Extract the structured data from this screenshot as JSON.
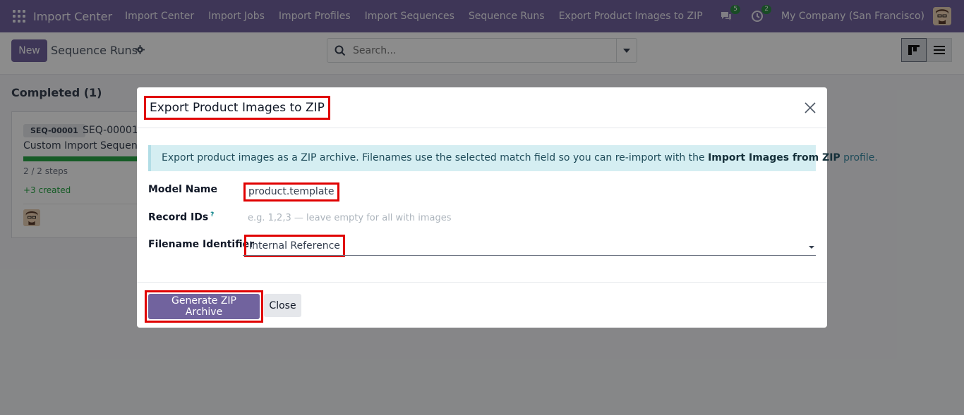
{
  "navbar": {
    "app_name": "Import Center",
    "menu": [
      "Import Center",
      "Import Jobs",
      "Import Profiles",
      "Import Sequences",
      "Sequence Runs",
      "Export Product Images to ZIP"
    ],
    "messages_count": "5",
    "activities_count": "2",
    "company": "My Company (San Francisco)"
  },
  "control": {
    "new_label": "New",
    "breadcrumb": "Sequence Runs",
    "search_placeholder": "Search..."
  },
  "kanban": {
    "group_title": "Completed (1)",
    "card": {
      "badge": "SEQ-00001",
      "name": "SEQ-00001 -",
      "description": "Custom Import Sequence",
      "progress": 1.0,
      "steps": "2 / 2 steps",
      "created": "+3 created"
    }
  },
  "dialog": {
    "title": "Export Product Images to ZIP",
    "alert_text_1": "Export product images as a ZIP archive. Filenames use the selected match field so you can re-import with the ",
    "alert_bold": "Import Images from ZIP",
    "alert_text_2": " profile.",
    "fields": {
      "model_name_label": "Model Name",
      "model_name_value": "product.template",
      "record_ids_label": "Record IDs",
      "record_ids_help": "?",
      "record_ids_placeholder": "e.g. 1,2,3 — leave empty for all with images",
      "filename_identifier_label": "Filename Identifier",
      "filename_identifier_value": "Internal Reference"
    },
    "generate_label": "Generate ZIP Archive",
    "close_label": "Close"
  },
  "colors": {
    "brand": "#71639e",
    "highlight": "#e00000",
    "success": "#28a745"
  }
}
